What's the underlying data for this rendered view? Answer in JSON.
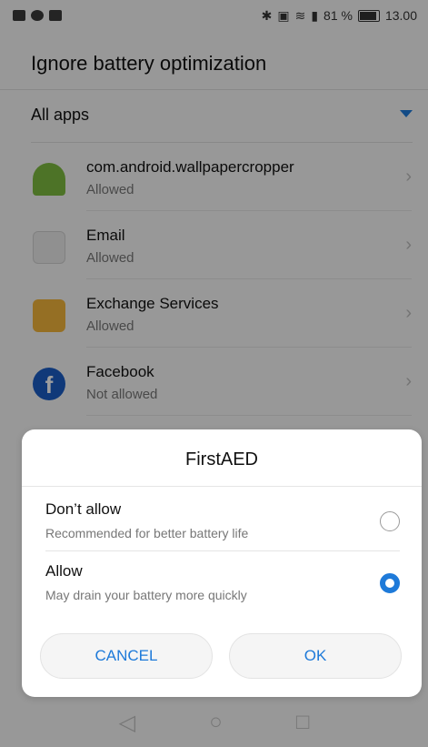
{
  "status_bar": {
    "left_icons": [
      "app-icon",
      "notification-icon",
      "mail-icon"
    ],
    "right_icons": [
      "bluetooth-icon",
      "nfc-icon",
      "wifi-icon",
      "signal-icon"
    ],
    "battery": "81 %",
    "time": "13.00"
  },
  "page": {
    "title": "Ignore battery optimization",
    "filter_label": "All apps",
    "filter_icon": "chevron-down-icon",
    "apps": [
      {
        "name": "com.android.wallpapercropper",
        "status": "Allowed",
        "icon": "android-icon"
      },
      {
        "name": "Email",
        "status": "Allowed",
        "icon": "email-icon"
      },
      {
        "name": "Exchange Services",
        "status": "Allowed",
        "icon": "exchange-icon"
      },
      {
        "name": "Facebook",
        "status": "Not allowed",
        "icon": "facebook-icon"
      }
    ]
  },
  "dialog": {
    "title": "FirstAED",
    "options": [
      {
        "title": "Don’t allow",
        "description": "Recommended for better battery life",
        "selected": false
      },
      {
        "title": "Allow",
        "description": "May drain your battery more quickly",
        "selected": true
      }
    ],
    "cancel_label": "CANCEL",
    "ok_label": "OK"
  },
  "colors": {
    "accent": "#1e7ad9"
  }
}
